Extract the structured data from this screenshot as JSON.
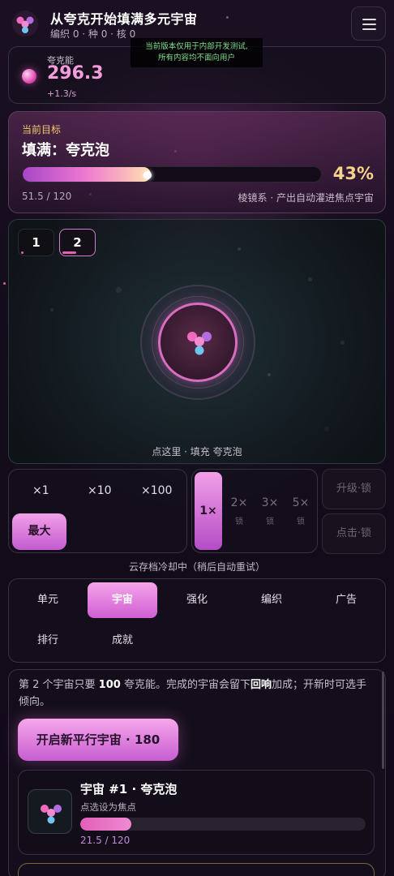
{
  "header": {
    "title": "从夸克开始填满多元宇宙",
    "stats": "编织 0 · 种 0 · 核 0",
    "notice_line1": "当前版本仅用于内部开发测试,",
    "notice_line2": "所有内容均不面向用户"
  },
  "resource": {
    "label": "夸克能",
    "value": "296.3",
    "rate": "+1.3/s"
  },
  "goal": {
    "label": "当前目标",
    "title": "填满：夸克泡",
    "progress": 0.43,
    "percent": "43%",
    "count": "51.5 / 120",
    "desc": "棱镜系 · 产出自动灌进焦点宇宙"
  },
  "bubble": {
    "tabs": [
      {
        "label": "1",
        "fill": 0.06
      },
      {
        "label": "2",
        "fill": 0.43
      }
    ],
    "hint": "点这里 · 填充 夸克泡"
  },
  "multiplier": {
    "options": [
      "×1",
      "×10",
      "×100"
    ],
    "max_label": "最大"
  },
  "speed": {
    "active": "1×",
    "options": [
      {
        "label": "2×",
        "lock": "锁"
      },
      {
        "label": "3×",
        "lock": "锁"
      },
      {
        "label": "5×",
        "lock": "锁"
      }
    ]
  },
  "side_buttons": {
    "upgrade": "升级·锁",
    "click": "点击·锁"
  },
  "cloud_status": "云存档冷却中（稍后自动重试）",
  "nav": {
    "tabs": [
      "单元",
      "宇宙",
      "强化",
      "编织",
      "广告",
      "排行",
      "成就"
    ],
    "active_index": 1
  },
  "info": {
    "text_part1": "第 2 个宇宙只要 ",
    "text_bold1": "100",
    "text_part2": " 夸克能。完成的宇宙会留下",
    "text_bold2": "回响",
    "text_part3": "加成；开新时可选手倾向。",
    "new_button": "开启新平行宇宙 · 180"
  },
  "universe_card": {
    "title": "宇宙 #1 · 夸克泡",
    "subtitle": "点选设为焦点",
    "progress": 0.179,
    "count": "21.5 / 120"
  },
  "colors": {
    "accent": "#e262c4",
    "gold": "#f5d48a",
    "notice_text": "#7de08a"
  }
}
